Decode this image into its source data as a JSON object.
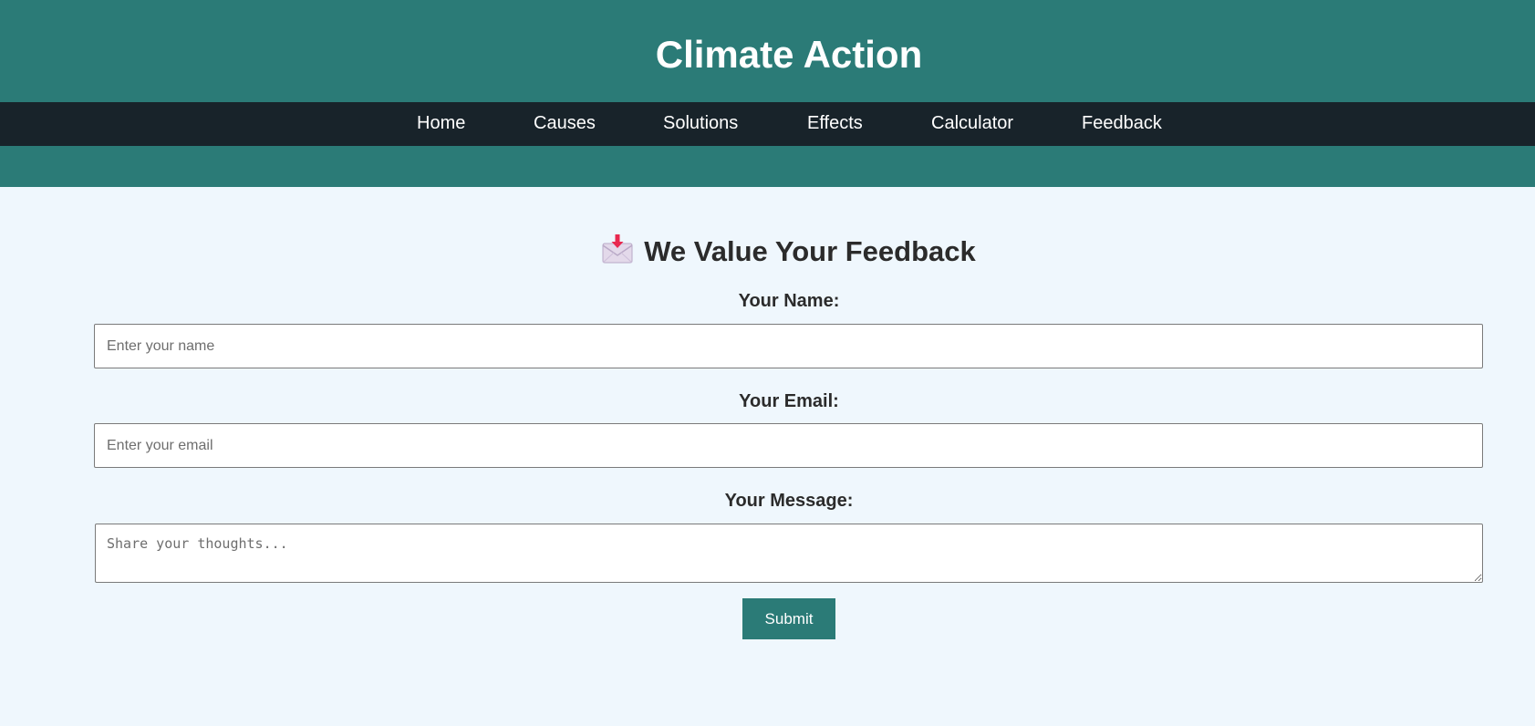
{
  "header": {
    "title": "Climate Action",
    "background_color": "#2b7b77"
  },
  "nav": {
    "background_color": "#18232a",
    "items": [
      {
        "label": "Home"
      },
      {
        "label": "Causes"
      },
      {
        "label": "Solutions"
      },
      {
        "label": "Effects"
      },
      {
        "label": "Calculator"
      },
      {
        "label": "Feedback"
      }
    ]
  },
  "form": {
    "heading": "We Value Your Feedback",
    "heading_icon": "envelope-with-arrow-icon",
    "name": {
      "label": "Your Name:",
      "placeholder": "Enter your name",
      "value": ""
    },
    "email": {
      "label": "Your Email:",
      "placeholder": "Enter your email",
      "value": ""
    },
    "message": {
      "label": "Your Message:",
      "placeholder": "Share your thoughts...",
      "value": ""
    },
    "submit_label": "Submit",
    "accent_color": "#2b7b77"
  },
  "page": {
    "background_color": "#eff7fd"
  }
}
